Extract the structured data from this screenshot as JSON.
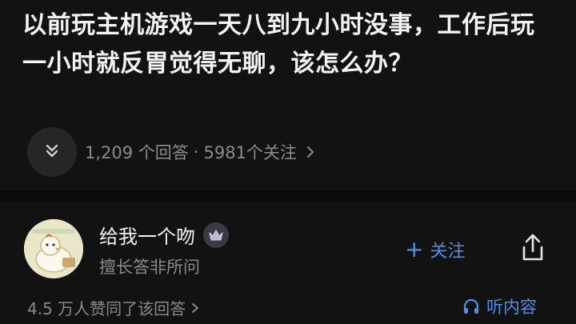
{
  "question": {
    "title": "以前玩主机游戏一天八到九小时没事，工作后玩一小时就反胃觉得无聊，该怎么办？"
  },
  "meta": {
    "answers": "1,209 个回答",
    "separator": "·",
    "followers": "5981个关注",
    "icons": {
      "collapse": "chevron-double-down-icon",
      "more": "chevron-right-icon"
    }
  },
  "author": {
    "name": "给我一个吻",
    "bio": "擅长答非所问",
    "follow_label": "关注",
    "follow_plus": "+",
    "badge_icon": "crown-icon",
    "share_icon": "share-icon"
  },
  "footer": {
    "likes": "4.5 万人赞同了该回答",
    "listen_label": "听内容",
    "listen_icon": "headphones-icon"
  },
  "colors": {
    "background": "#121212",
    "accent": "#4d8ff0",
    "muted": "#8a8a8a"
  }
}
